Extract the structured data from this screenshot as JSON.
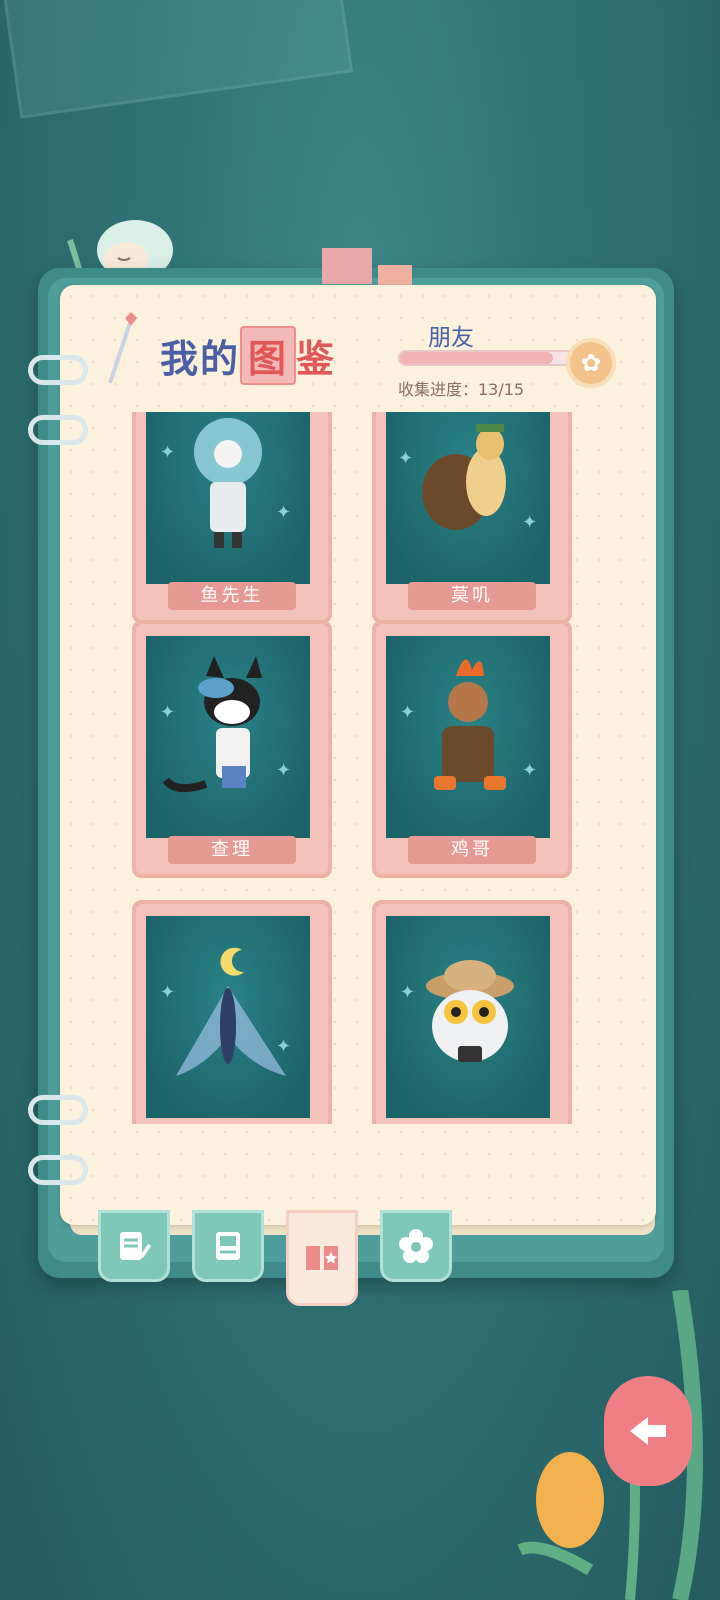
{
  "header": {
    "title_prefix": "我的",
    "title_highlight": "图",
    "title_suffix": "鉴",
    "category": "朋友",
    "progress_label": "收集进度：13/15",
    "progress_fraction": 0.867
  },
  "cards": [
    {
      "name": "鱼先生",
      "color": "#1f6c72"
    },
    {
      "name": "莫叽",
      "color": "#1f6c72"
    },
    {
      "name": "查理",
      "color": "#1f6c72"
    },
    {
      "name": "鸡哥",
      "color": "#1f6c72"
    },
    {
      "name": "",
      "color": "#1f6c72"
    },
    {
      "name": "",
      "color": "#1f6c72"
    }
  ],
  "tabs": [
    {
      "icon": "notebook-pencil-icon"
    },
    {
      "icon": "photo-album-icon"
    },
    {
      "icon": "collection-book-icon"
    },
    {
      "icon": "flower-badge-icon"
    }
  ],
  "colors": {
    "accent": "#e79a93",
    "title_blue": "#4a5fa4",
    "tab_green": "#7fc7b8"
  }
}
